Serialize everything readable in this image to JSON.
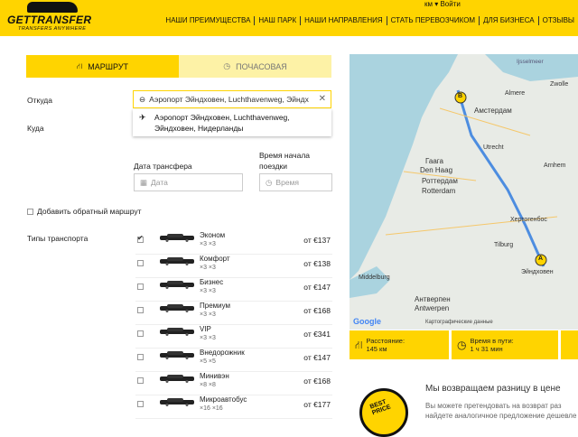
{
  "header": {
    "brand": "GETTRANSFER",
    "tagline": "TRANSFERS ANYWHERE",
    "topstrip": "км   ▾   Войти",
    "nav": [
      "НАШИ ПРЕИМУЩЕСТВА",
      "НАШ ПАРК",
      "НАШИ НАПРАВЛЕНИЯ",
      "СТАТЬ ПЕРЕВОЗЧИКОМ",
      "ДЛЯ БИЗНЕСА",
      "ОТЗЫВЫ"
    ]
  },
  "tabs": {
    "route": "МАРШРУТ",
    "hourly": "ПОЧАСОВАЯ"
  },
  "form": {
    "from_label": "Откуда",
    "from_value": "Аэропорт Эйндховен, Luchthavenweg, Эйндх",
    "suggestion_line1": "Аэропорт Эйндховен, Luchthavenweg,",
    "suggestion_line2": "Эйндховен, Нидерланды",
    "to_label": "Куда",
    "date_label": "Дата трансфера",
    "date_placeholder": "Дата",
    "time_label1": "Время начала",
    "time_label2": "поездки",
    "time_placeholder": "Время",
    "return_label": "Добавить обратный маршрут",
    "types_label": "Типы транспорта"
  },
  "transport": [
    {
      "name": "Эконом",
      "cap": "×3  ×3",
      "price": "от €137",
      "checked": true
    },
    {
      "name": "Комфорт",
      "cap": "×3  ×3",
      "price": "от €138",
      "checked": false
    },
    {
      "name": "Бизнес",
      "cap": "×3  ×3",
      "price": "от €147",
      "checked": false
    },
    {
      "name": "Премиум",
      "cap": "×3  ×3",
      "price": "от €168",
      "checked": false
    },
    {
      "name": "VIP",
      "cap": "×3  ×3",
      "price": "от €341",
      "checked": false
    },
    {
      "name": "Внедорожник",
      "cap": "×5  ×5",
      "price": "от €147",
      "checked": false
    },
    {
      "name": "Минивэн",
      "cap": "×8  ×8",
      "price": "от €168",
      "checked": false
    },
    {
      "name": "Микроавтобус",
      "cap": "×16  ×16",
      "price": "от €177",
      "checked": false
    }
  ],
  "map": {
    "cities": [
      "Амстердам",
      "Гаага",
      "Den Haag",
      "Роттердам",
      "Rotterdam",
      "Антверпен",
      "Antwerpen",
      "Middelburg",
      "Tilburg",
      "Хертогенбос",
      "Эйндховен",
      "Utrecht",
      "Ijsselmeer",
      "Almere",
      "Zwolle",
      "Arnhem"
    ],
    "footer": "Картографические данные",
    "google": "Google"
  },
  "summary": {
    "distance_label": "Расстояние:",
    "distance_value": "145 км",
    "time_label": "Время в пути:",
    "time_value": "1 ч 31 мин"
  },
  "promo": {
    "badge": "BEST PRICE",
    "title": "Мы возвращаем разницу в цене",
    "text1": "Вы можете претендовать на возврат раз",
    "text2": "найдете аналогичное предложение дешевле"
  },
  "colors": {
    "accent": "#ffd400",
    "tab_inactive": "#fdf2a6"
  }
}
